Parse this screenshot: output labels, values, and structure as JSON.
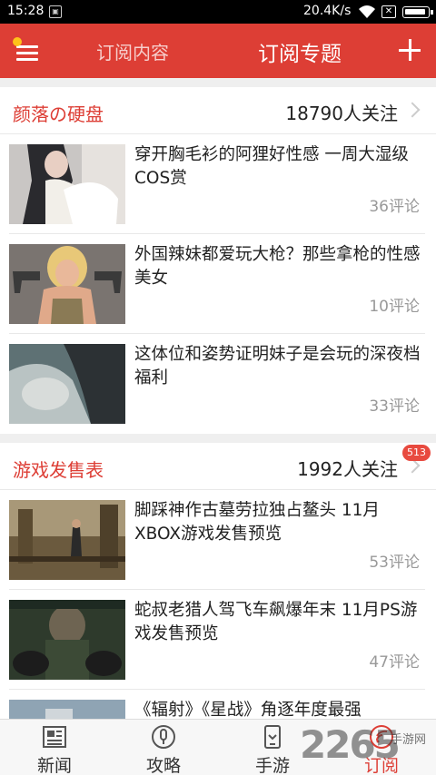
{
  "status_bar": {
    "time": "15:28",
    "network_speed": "20.4K/s"
  },
  "app_bar": {
    "tab_inactive": "订阅内容",
    "tab_active": "订阅专题",
    "menu_icon": "menu-icon",
    "add_icon": "plus-icon",
    "accent_color": "#dd3e35"
  },
  "sections": [
    {
      "title": "颜落の硬盘",
      "followers": "18790人关注",
      "articles": [
        {
          "title": "穿开胸毛衫的阿狸好性感 一周大湿级COS赏",
          "comments": "36评论"
        },
        {
          "title": "外国辣妹都爱玩大枪？那些拿枪的性感美女",
          "comments": "10评论"
        },
        {
          "title": "这体位和姿势证明妹子是会玩的深夜档福利",
          "comments": "33评论"
        }
      ]
    },
    {
      "title": "游戏发售表",
      "followers": "1992人关注",
      "badge": "513",
      "articles": [
        {
          "title": "脚踩神作古墓劳拉独占鳌头 11月XBOX游戏发售预览",
          "comments": "53评论"
        },
        {
          "title": "蛇叔老猎人驾飞车飙爆年末 11月PS游戏发售预览",
          "comments": "47评论"
        },
        {
          "title": "《辐射》《星战》角逐年度最强",
          "comments": ""
        }
      ]
    }
  ],
  "bottom_nav": [
    {
      "label": "新闻",
      "icon": "newspaper-icon"
    },
    {
      "label": "攻略",
      "icon": "guide-icon"
    },
    {
      "label": "手游",
      "icon": "phone-icon"
    },
    {
      "label": "订阅",
      "icon": "subscribe-icon",
      "active": true
    }
  ],
  "watermark": {
    "text": "2265",
    "sub": "手游网"
  }
}
